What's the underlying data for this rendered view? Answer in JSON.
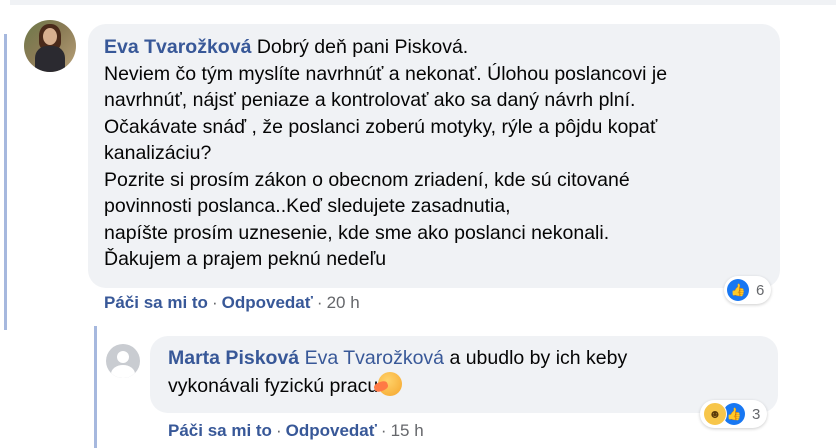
{
  "comments": [
    {
      "author": "Eva Tvarožková",
      "lines": [
        " Dobrý deň pani Pisková.",
        "Neviem čo tým myslíte navrhnúť a nekonať. Úlohou poslancovi je",
        "navrhnúť, nájsť peniaze a kontrolovať ako sa daný návrh plní.",
        "Očakávate snáď , že poslanci zoberú motyky, rýle a pôjdu kopať",
        "kanalizáciu?",
        "Pozrite si prosím zákon o obecnom zriadení, kde sú citované",
        "povinnosti poslanca..Keď sledujete zasadnutia,",
        "napíšte prosím uznesenie, kde sme ako poslanci nekonali.",
        "Ďakujem a prajem peknú nedeľu"
      ],
      "like_label": "Páči sa mi to",
      "reply_label": "Odpovedať",
      "time": "20 h",
      "reaction_count": "6"
    },
    {
      "author": "Marta Pisková",
      "mention": "Eva Tvarožková",
      "line1_rest": " a ubudlo by ich keby",
      "line2": "vykonávali fyzickú pracu",
      "like_label": "Páči sa mi to",
      "reply_label": "Odpovedať",
      "time": "15 h",
      "reaction_count": "3"
    }
  ],
  "separator": "·",
  "icons": {
    "like": "like-icon",
    "haha": "haha-icon",
    "emoji": "hot-face-emoji"
  },
  "colors": {
    "author": "#385898",
    "bubble": "#f0f2f5",
    "thread_line": "#a6b8de",
    "meta": "#65676b"
  }
}
